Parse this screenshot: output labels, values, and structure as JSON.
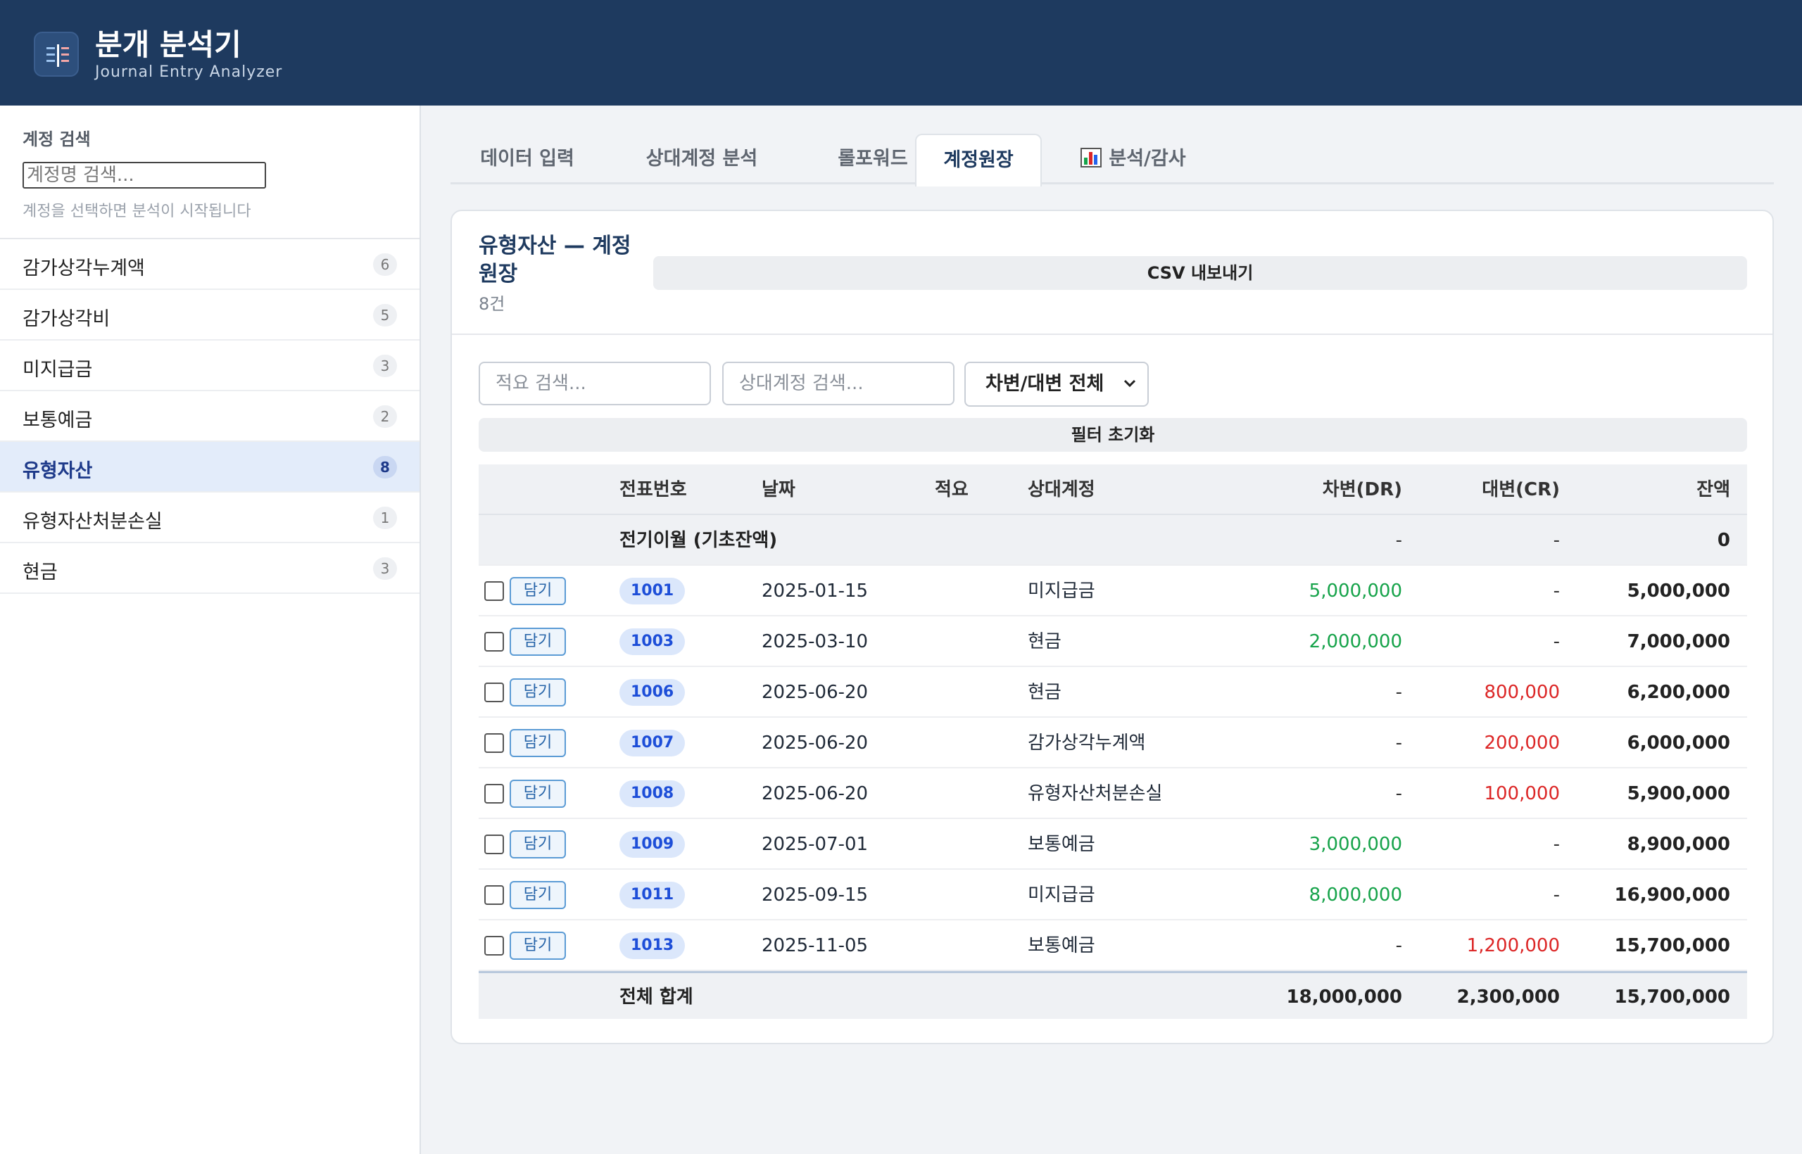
{
  "app": {
    "title": "분개 분석기",
    "subtitle": "Journal Entry Analyzer"
  },
  "sidebar": {
    "search_label": "계정 검색",
    "search_placeholder": "계정명 검색...",
    "hint": "계정을 선택하면 분석이 시작됩니다",
    "items": [
      {
        "label": "감가상각누계액",
        "count": "6"
      },
      {
        "label": "감가상각비",
        "count": "5"
      },
      {
        "label": "미지급금",
        "count": "3"
      },
      {
        "label": "보통예금",
        "count": "2"
      },
      {
        "label": "유형자산",
        "count": "8"
      },
      {
        "label": "유형자산처분손실",
        "count": "1"
      },
      {
        "label": "현금",
        "count": "3"
      }
    ],
    "active_item": "유형자산"
  },
  "tabs": [
    {
      "label": "데이터 입력"
    },
    {
      "label": "상대계정 분석"
    },
    {
      "label": "롤포워드"
    },
    {
      "label": "계정원장"
    },
    {
      "label": "분석/감사",
      "icon": "bar-chart-icon"
    }
  ],
  "active_tab": "계정원장",
  "ledger": {
    "title": "유형자산 — 계정원장",
    "count": "8건",
    "csv_button": "CSV 내보내기",
    "memo_placeholder": "적요 검색...",
    "counterpart_placeholder": "상대계정 검색...",
    "side_filter": "차변/대변 전체",
    "reset_button": "필터 초기화",
    "add_label": "담기",
    "columns": {
      "voucher": "전표번호",
      "date": "날짜",
      "memo": "적요",
      "counterpart": "상대계정",
      "debit": "차변(DR)",
      "credit": "대변(CR)",
      "balance": "잔액"
    },
    "opening": {
      "label": "전기이월 (기초잔액)",
      "debit": "-",
      "credit": "-",
      "balance": "0"
    },
    "rows": [
      {
        "voucher": "1001",
        "date": "2025-01-15",
        "memo": "",
        "counterpart": "미지급금",
        "debit": "5,000,000",
        "credit": "-",
        "balance": "5,000,000"
      },
      {
        "voucher": "1003",
        "date": "2025-03-10",
        "memo": "",
        "counterpart": "현금",
        "debit": "2,000,000",
        "credit": "-",
        "balance": "7,000,000"
      },
      {
        "voucher": "1006",
        "date": "2025-06-20",
        "memo": "",
        "counterpart": "현금",
        "debit": "-",
        "credit": "800,000",
        "balance": "6,200,000"
      },
      {
        "voucher": "1007",
        "date": "2025-06-20",
        "memo": "",
        "counterpart": "감가상각누계액",
        "debit": "-",
        "credit": "200,000",
        "balance": "6,000,000"
      },
      {
        "voucher": "1008",
        "date": "2025-06-20",
        "memo": "",
        "counterpart": "유형자산처분손실",
        "debit": "-",
        "credit": "100,000",
        "balance": "5,900,000"
      },
      {
        "voucher": "1009",
        "date": "2025-07-01",
        "memo": "",
        "counterpart": "보통예금",
        "debit": "3,000,000",
        "credit": "-",
        "balance": "8,900,000"
      },
      {
        "voucher": "1011",
        "date": "2025-09-15",
        "memo": "",
        "counterpart": "미지급금",
        "debit": "8,000,000",
        "credit": "-",
        "balance": "16,900,000"
      },
      {
        "voucher": "1013",
        "date": "2025-11-05",
        "memo": "",
        "counterpart": "보통예금",
        "debit": "-",
        "credit": "1,200,000",
        "balance": "15,700,000"
      }
    ],
    "total": {
      "label": "전체 합계",
      "debit": "18,000,000",
      "credit": "2,300,000",
      "balance": "15,700,000"
    }
  },
  "colors": {
    "header_bg": "#1e3a5f",
    "debit": "#16a34a",
    "credit": "#dc2626",
    "accent": "#1d4ed8"
  }
}
